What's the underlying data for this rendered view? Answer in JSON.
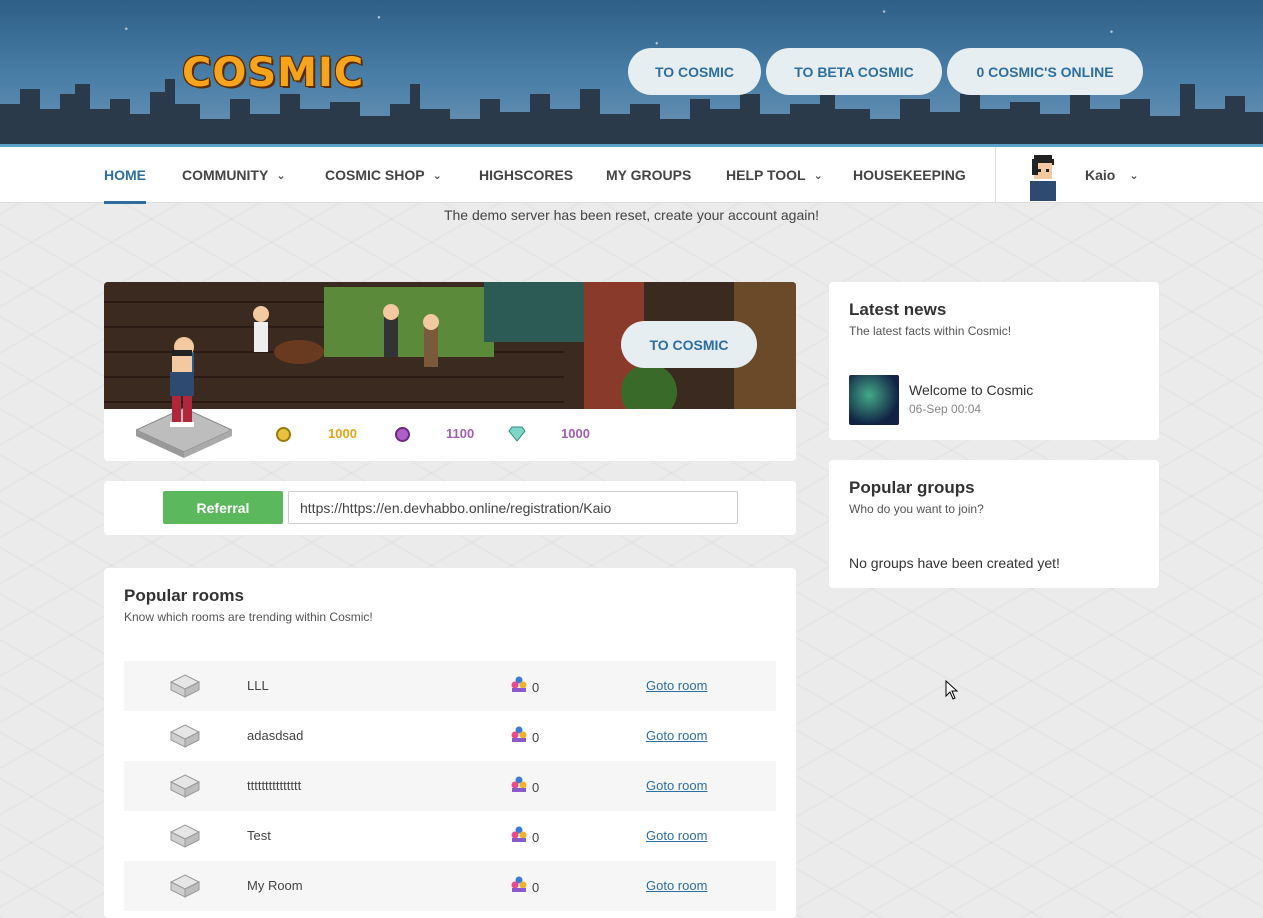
{
  "header": {
    "logo": "COSMIC",
    "buttons": [
      "TO COSMIC",
      "TO BETA COSMIC",
      "0 COSMIC'S ONLINE"
    ]
  },
  "nav": {
    "items": [
      {
        "label": "HOME",
        "active": true
      },
      {
        "label": "COMMUNITY",
        "dropdown": true
      },
      {
        "label": "COSMIC SHOP",
        "dropdown": true
      },
      {
        "label": "HIGHSCORES"
      },
      {
        "label": "MY GROUPS"
      },
      {
        "label": "HELP TOOL",
        "dropdown": true
      },
      {
        "label": "HOUSEKEEPING"
      }
    ],
    "user": "Kaio"
  },
  "notice": "The demo server has been reset, create your account again!",
  "profile": {
    "banner_button": "TO COSMIC",
    "credits": "1000",
    "duckets": "1100",
    "diamonds": "1000"
  },
  "referral": {
    "button": "Referral",
    "url": "https://https://en.devhabbo.online/registration/Kaio"
  },
  "popular_rooms": {
    "title": "Popular rooms",
    "subtitle": "Know which rooms are trending within Cosmic!",
    "goto_label": "Goto room",
    "rooms": [
      {
        "name": "LLL",
        "users": "0"
      },
      {
        "name": "adasdsad",
        "users": "0"
      },
      {
        "name": "ttttttttttttttt",
        "users": "0"
      },
      {
        "name": "Test",
        "users": "0"
      },
      {
        "name": "My Room",
        "users": "0"
      }
    ]
  },
  "news": {
    "title": "Latest news",
    "subtitle": "The latest facts within Cosmic!",
    "items": [
      {
        "title": "Welcome to Cosmic",
        "date": "06-Sep 00:04"
      }
    ]
  },
  "groups": {
    "title": "Popular groups",
    "subtitle": "Who do you want to join?",
    "empty": "No groups have been created yet!"
  },
  "colors": {
    "accent": "#2e6e9e",
    "credits": "#e8a317",
    "duckets": "#a35fb5",
    "diamonds": "#a35fb5",
    "referral": "#5cb85c"
  }
}
